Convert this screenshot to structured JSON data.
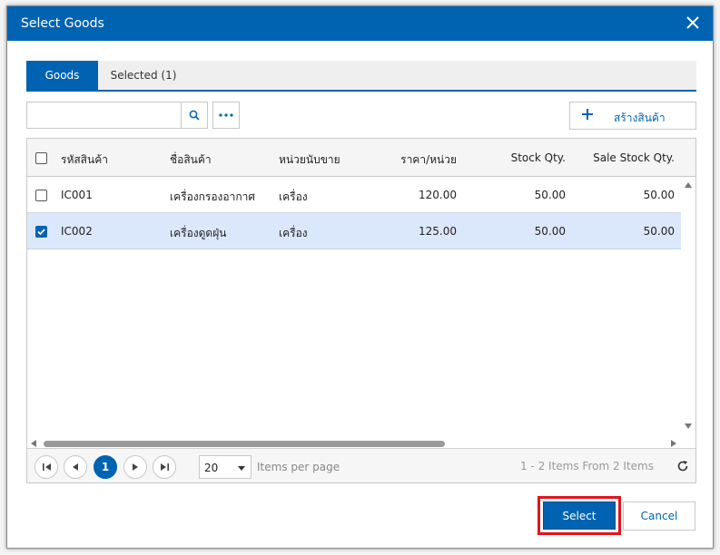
{
  "dialog": {
    "title": "Select Goods"
  },
  "tabs": [
    {
      "label": "Goods",
      "active": true
    },
    {
      "label": "Selected (1)",
      "active": false
    }
  ],
  "search": {
    "value": "",
    "placeholder": ""
  },
  "toolbar": {
    "create_label": "สร้างสินค้า"
  },
  "grid": {
    "columns": [
      "รหัสสินค้า",
      "ชื่อสินค้า",
      "หน่วยนับขาย",
      "ราคา/หน่วย",
      "Stock Qty.",
      "Sale Stock Qty."
    ],
    "rows": [
      {
        "code": "IC001",
        "name": "เครื่องกรองอากาศ",
        "unit": "เครื่อง",
        "price": "120.00",
        "stock": "50.00",
        "sale_stock": "50.00",
        "checked": false
      },
      {
        "code": "IC002",
        "name": "เครื่องดูดฝุ่น",
        "unit": "เครื่อง",
        "price": "125.00",
        "stock": "50.00",
        "sale_stock": "50.00",
        "checked": true
      }
    ]
  },
  "pager": {
    "current_page": "1",
    "page_size": "20",
    "items_per_page_label": "Items per page",
    "info": "1 - 2 Items From 2 Items"
  },
  "footer": {
    "select_label": "Select",
    "cancel_label": "Cancel"
  },
  "colors": {
    "accent": "#0063b1",
    "highlight_frame": "#e0141e",
    "selected_row": "#dbe8fb"
  }
}
